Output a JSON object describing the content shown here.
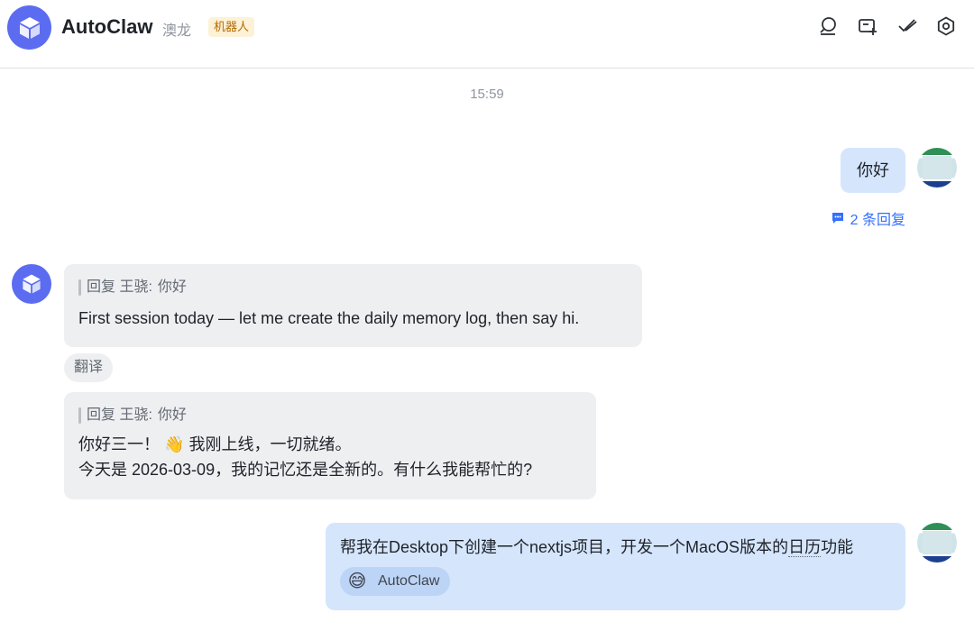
{
  "header": {
    "title": "AutoClaw",
    "alias": "澳龙",
    "badge": "机器人",
    "icons": [
      "search-icon",
      "new-topic-icon",
      "check-icon",
      "settings-icon"
    ]
  },
  "chat": {
    "timestamp": "15:59",
    "messages": [
      {
        "sender": "user",
        "text": "你好",
        "reply_count_label": "2 条回复"
      },
      {
        "sender": "bot",
        "quote_prefix": "回复 王骁:",
        "quote_text": "你好",
        "text": "First session today — let me create the daily memory log, then say hi.",
        "translate_label": "翻译"
      },
      {
        "sender": "bot",
        "quote_prefix": "回复 王骁:",
        "quote_text": "你好",
        "text_line1_a": "你好三一！",
        "emoji": "👋",
        "text_line1_b": "我刚上线，一切就绪。",
        "text_line2": "今天是 2026-03-09，我的记忆还是全新的。有什么我能帮忙的?"
      },
      {
        "sender": "user",
        "text_main": "帮我在Desktop下创建一个nextjs项目，开发一个MacOS版本的",
        "text_underlined": "日历",
        "text_tail": "功能",
        "mention_emoji": "😅",
        "mention_label": "AutoClaw"
      }
    ]
  },
  "colors": {
    "accent": "#3370ff",
    "bot_avatar": "#5b6cf0",
    "user_bubble": "#d5e5fc",
    "bot_bubble": "#eeeff1",
    "badge_bg": "#fdf1d6",
    "badge_text": "#b26b00"
  }
}
